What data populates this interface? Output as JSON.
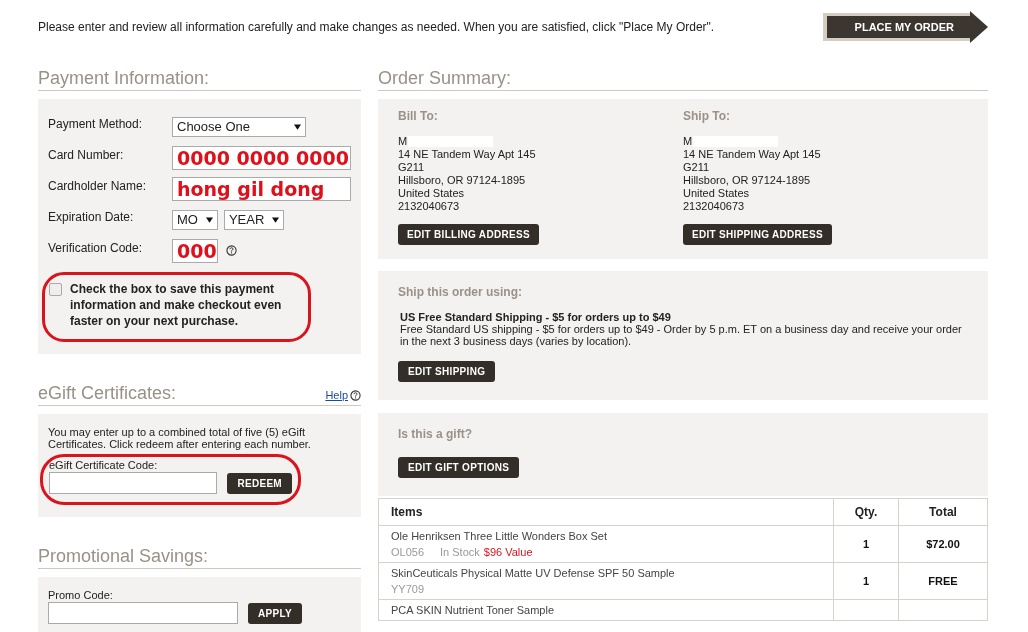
{
  "intro": "Please enter and review all information carefully and make changes as needed. When you are satisfied, click \"Place My Order\".",
  "place_order_button": "PLACE MY ORDER",
  "payment": {
    "heading": "Payment Information:",
    "fields": [
      {
        "kind": "select",
        "label": "Payment Method:",
        "values": [
          "Choose One"
        ]
      },
      {
        "kind": "text",
        "label": "Card Number:",
        "value": "0000 0000 0000"
      },
      {
        "kind": "text",
        "label": "Cardholder Name:",
        "value": "hong gil dong"
      },
      {
        "kind": "select",
        "label": "Expiration Date:",
        "values": [
          "MO",
          "YEAR"
        ]
      },
      {
        "kind": "code",
        "label": "Verification Code:",
        "value": "000"
      }
    ],
    "save_option": {
      "label": "Check the box to save this payment information and make checkout even faster on your next purchase.",
      "checked": false
    }
  },
  "egift": {
    "heading": "eGift Certificates:",
    "help_link": "Help",
    "note": "You may enter up to a combined total of five (5) eGift Certificates. Click redeem after entering each number.",
    "field_label": "eGift Certificate Code:",
    "button": "REDEEM"
  },
  "promo": {
    "heading": "Promotional Savings:",
    "field_label": "Promo Code:",
    "button": "APPLY"
  },
  "order_summary": {
    "heading": "Order Summary:",
    "addresses": [
      {
        "title": "Bill To:",
        "lines": [
          "M",
          "14 NE Tandem Way Apt 145",
          "G211",
          "Hillsboro, OR 97124-1895",
          "United States",
          "2132040673"
        ],
        "button": "EDIT BILLING ADDRESS"
      },
      {
        "title": "Ship To:",
        "lines": [
          "M",
          "14 NE Tandem Way Apt 145",
          "G211",
          "Hillsboro, OR 97124-1895",
          "United States",
          "2132040673"
        ],
        "button": "EDIT SHIPPING ADDRESS"
      }
    ],
    "shipping": {
      "title": "Ship this order using:",
      "method": "US Free Standard Shipping - $5 for orders up to $49",
      "description": "Free Standard US shipping - $5 for orders up to $49 - Order by 5 p.m. ET on a business day and receive your order in the next 3 business days (varies by location).",
      "button": "EDIT SHIPPING"
    },
    "gift": {
      "title": "Is this a gift?",
      "button": "EDIT GIFT OPTIONS"
    },
    "table": {
      "columns": [
        "Items",
        "Qty.",
        "Total"
      ],
      "rows": [
        {
          "name": "Ole Henriksen Three Little Wonders Box Set",
          "sku": "OL056",
          "stock": "In Stock",
          "value": "$96 Value",
          "qty": "1",
          "total": "$72.00"
        },
        {
          "name": "SkinCeuticals Physical Matte UV Defense SPF 50 Sample",
          "sku": "YY709",
          "qty": "1",
          "total": "FREE"
        },
        {
          "name": "PCA SKIN Nutrient Toner Sample"
        }
      ]
    }
  }
}
